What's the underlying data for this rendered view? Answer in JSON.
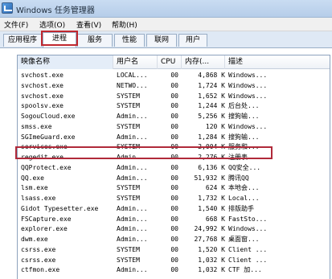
{
  "window": {
    "title": "Windows 任务管理器"
  },
  "menu": {
    "items": [
      "文件(F)",
      "选项(O)",
      "查看(V)",
      "帮助(H)"
    ]
  },
  "tabs": [
    {
      "label": "应用程序"
    },
    {
      "label": "进程"
    },
    {
      "label": "服务"
    },
    {
      "label": "性能"
    },
    {
      "label": "联网"
    },
    {
      "label": "用户"
    }
  ],
  "active_tab": "进程",
  "highlight_color": "#c0282f",
  "columns": {
    "name": "映像名称",
    "user": "用户名",
    "cpu": "CPU",
    "mem": "内存(...",
    "desc": "描述"
  },
  "processes": [
    {
      "name": "svchost.exe",
      "user": "LOCAL...",
      "cpu": "00",
      "mem": "4,868 K",
      "desc": "Windows..."
    },
    {
      "name": "svchost.exe",
      "user": "NETWO...",
      "cpu": "00",
      "mem": "1,724 K",
      "desc": "Windows..."
    },
    {
      "name": "svchost.exe",
      "user": "SYSTEM",
      "cpu": "00",
      "mem": "1,652 K",
      "desc": "Windows..."
    },
    {
      "name": "spoolsv.exe",
      "user": "SYSTEM",
      "cpu": "00",
      "mem": "1,244 K",
      "desc": "后台处..."
    },
    {
      "name": "SogouCloud.exe",
      "user": "Admin...",
      "cpu": "00",
      "mem": "5,256 K",
      "desc": "搜狗输..."
    },
    {
      "name": "smss.exe",
      "user": "SYSTEM",
      "cpu": "00",
      "mem": "120 K",
      "desc": "Windows..."
    },
    {
      "name": "SGImeGuard.exe",
      "user": "Admin...",
      "cpu": "00",
      "mem": "1,284 K",
      "desc": "搜狗输..."
    },
    {
      "name": "services.exe",
      "user": "SYSTEM",
      "cpu": "00",
      "mem": "2,004 K",
      "desc": "服务和..."
    },
    {
      "name": "regedit.exe",
      "user": "Admin...",
      "cpu": "00",
      "mem": "2,276 K",
      "desc": "注册表..."
    },
    {
      "name": "QQProtect.exe",
      "user": "Admin...",
      "cpu": "00",
      "mem": "6,136 K",
      "desc": "QQ安全..."
    },
    {
      "name": "QQ.exe",
      "user": "Admin...",
      "cpu": "00",
      "mem": "51,932 K",
      "desc": "腾讯QQ"
    },
    {
      "name": "lsm.exe",
      "user": "SYSTEM",
      "cpu": "00",
      "mem": "624 K",
      "desc": "本地会..."
    },
    {
      "name": "lsass.exe",
      "user": "SYSTEM",
      "cpu": "00",
      "mem": "1,732 K",
      "desc": "Local..."
    },
    {
      "name": "Gidot Typesetter.exe",
      "user": "Admin...",
      "cpu": "00",
      "mem": "1,540 K",
      "desc": "排版助手"
    },
    {
      "name": "FSCapture.exe",
      "user": "Admin...",
      "cpu": "00",
      "mem": "668 K",
      "desc": "FastSto..."
    },
    {
      "name": "explorer.exe",
      "user": "Admin...",
      "cpu": "00",
      "mem": "24,992 K",
      "desc": "Windows..."
    },
    {
      "name": "dwm.exe",
      "user": "Admin...",
      "cpu": "00",
      "mem": "27,768 K",
      "desc": "桌面窗..."
    },
    {
      "name": "csrss.exe",
      "user": "SYSTEM",
      "cpu": "00",
      "mem": "1,520 K",
      "desc": "Client ..."
    },
    {
      "name": "csrss.exe",
      "user": "SYSTEM",
      "cpu": "00",
      "mem": "1,032 K",
      "desc": "Client ..."
    },
    {
      "name": "ctfmon.exe",
      "user": "Admin...",
      "cpu": "00",
      "mem": "1,032 K",
      "desc": "CTF 加..."
    }
  ]
}
